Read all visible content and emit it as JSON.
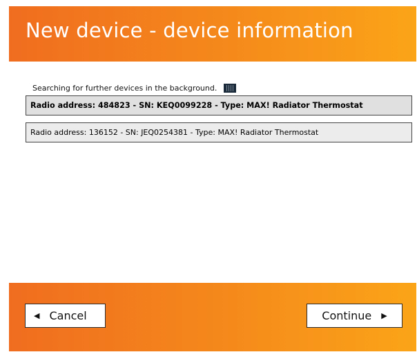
{
  "dialog": {
    "title": "New device - device information"
  },
  "status": {
    "text": "Searching for further devices in the background.",
    "icon": "progress-indicator-icon"
  },
  "devices": [
    {
      "label": "Radio address: 484823 - SN: KEQ0099228 - Type: MAX! Radiator Thermostat",
      "selected": true
    },
    {
      "label": "Radio address: 136152 - SN: JEQ0254381 - Type: MAX! Radiator Thermostat",
      "selected": false
    }
  ],
  "footer": {
    "cancel_label": "Cancel",
    "continue_label": "Continue",
    "cancel_icon": "triangle-left-icon",
    "continue_icon": "triangle-right-icon"
  },
  "colors": {
    "header_gradient_start": "#f06d1f",
    "header_gradient_end": "#fba418",
    "title_text": "#ffffff"
  }
}
